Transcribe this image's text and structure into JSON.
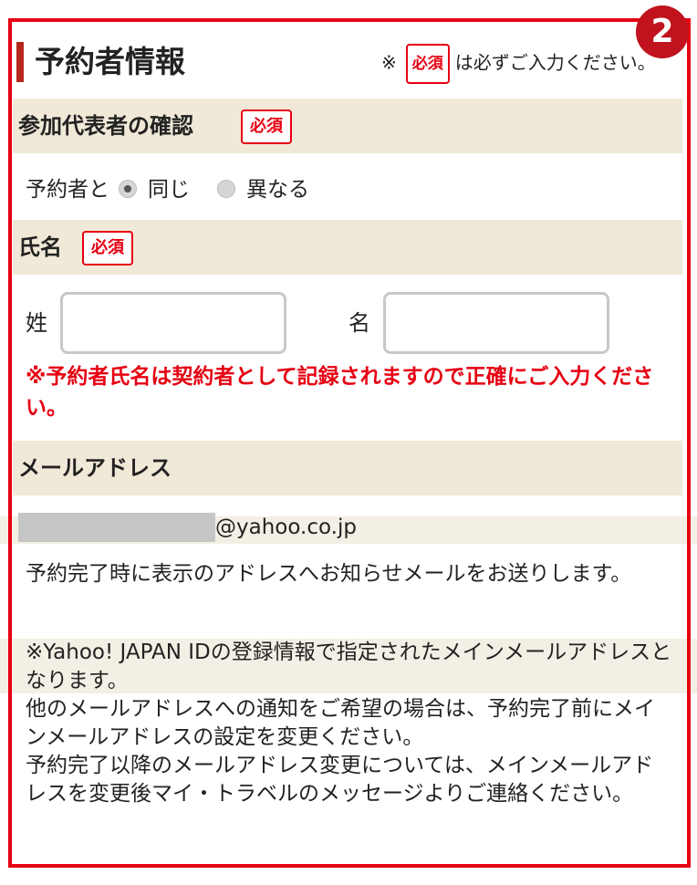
{
  "step_number": "2",
  "section": {
    "title": "予約者情報",
    "required_note_prefix": "※",
    "required_badge": "必須",
    "required_note_suffix": "は必ずご入力ください。"
  },
  "representative": {
    "heading": "参加代表者の確認",
    "required_badge": "必須",
    "prefix": "予約者と",
    "options": [
      {
        "label": "同じ",
        "selected": true
      },
      {
        "label": "異なる",
        "selected": false
      }
    ]
  },
  "name": {
    "heading": "氏名",
    "required_badge": "必須",
    "last_label": "姓",
    "last_value": "",
    "first_label": "名",
    "first_value": "",
    "warning": "※予約者氏名は契約者として記録されますので正確にご入力ください。"
  },
  "email": {
    "heading": "メールアドレス",
    "domain": "@yahoo.co.jp",
    "note1": "予約完了時に表示のアドレスへお知らせメールをお送りします。",
    "note2_lines": [
      "※Yahoo! JAPAN IDの登録情報で指定されたメインメールアドレスとなります。",
      "他のメールアドレスへの通知をご希望の場合は、予約完了前にメインメールアドレスの設定を変更ください。",
      "予約完了以降のメールアドレス変更については、メインメールアドレスを変更後マイ・トラベルのメッセージよりご連絡ください。"
    ]
  },
  "colors": {
    "accent_red": "#e60012",
    "badge_red": "#c0131d",
    "section_bg": "#f1e9d8"
  }
}
